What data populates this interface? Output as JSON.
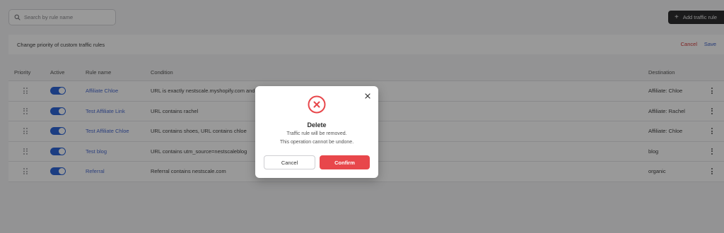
{
  "search": {
    "placeholder": "Search by rule name",
    "icon": "search-icon"
  },
  "header": {
    "add_rule_label": "Add traffic rule"
  },
  "priority_bar": {
    "label": "Change priority of custom traffic rules",
    "cancel_label": "Cancel",
    "save_label": "Save"
  },
  "table": {
    "columns": {
      "priority": "Priority",
      "active": "Active",
      "rule_name": "Rule name",
      "condition": "Condition",
      "destination": "Destination"
    },
    "rows": [
      {
        "name": "Affiliate Chloe",
        "condition": "URL is exactly nestscale.myshopify.com and",
        "destination": "Affiliate: Chloe",
        "active": true
      },
      {
        "name": "Test Affiliate Link",
        "condition": "URL contains rachel",
        "destination": "Affiliate: Rachel",
        "active": true
      },
      {
        "name": "Test Affiliate Chloe",
        "condition": "URL contains shoes, URL contains chloe",
        "destination": "Affiliate: Chloe",
        "active": true
      },
      {
        "name": "Test blog",
        "condition": "URL contains utm_source=nestscaleblog",
        "destination": "blog",
        "active": true
      },
      {
        "name": "Referral",
        "condition": "Referral contains nestscale.com",
        "destination": "organic",
        "active": true
      }
    ]
  },
  "modal": {
    "title": "Delete",
    "description_line1": "Traffic rule will be removed.",
    "description_line2": "This operation cannot be undone.",
    "cancel_label": "Cancel",
    "confirm_label": "Confirm",
    "icon": "error-circle-icon",
    "danger_color": "#e8474b"
  },
  "colors": {
    "accent": "#2e66d9",
    "link": "#4a6ad0",
    "danger": "#d23a3a"
  }
}
